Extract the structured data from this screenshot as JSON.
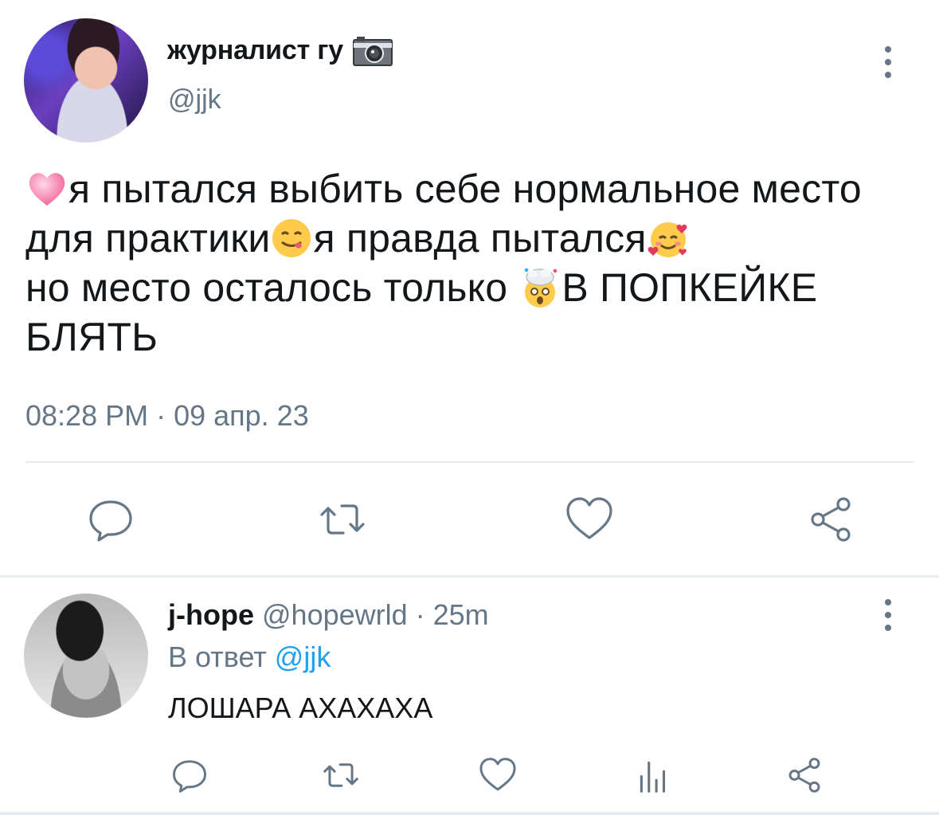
{
  "main_tweet": {
    "display_name": "журналист гу",
    "name_emoji": "camera-icon",
    "handle": "@jjk",
    "text_parts": [
      "я пытался выбить себе нормальное место для практики",
      "я правда пытался",
      "но место осталось только ",
      "В ПОПКЕЙКЕ БЛЯТЬ"
    ],
    "emojis": [
      "growing-heart-emoji",
      "yum-emoji",
      "smiling-hearts-emoji",
      "exploding-head-emoji"
    ],
    "timestamp": "08:28 PM · 09 апр. 23",
    "actions": [
      "reply-icon",
      "retweet-icon",
      "like-icon",
      "share-icon"
    ]
  },
  "reply": {
    "display_name": "j-hope",
    "handle": "@hopewrld",
    "separator": " · ",
    "time": "25m",
    "reply_prefix": "В ответ ",
    "reply_mention": "@jjk",
    "text": "ЛОШАРА АХАХАХА",
    "actions": [
      "reply-icon",
      "retweet-icon",
      "like-icon",
      "analytics-icon",
      "share-icon"
    ]
  },
  "colors": {
    "text": "#14171a",
    "secondary": "#657786",
    "link": "#1da1f2",
    "divider": "#e6ecf0"
  }
}
